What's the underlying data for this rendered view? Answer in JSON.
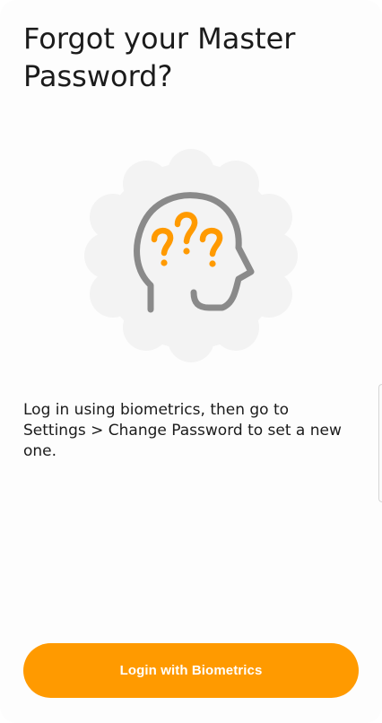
{
  "screen": {
    "title": "Forgot your Master Password?",
    "description": "Log in using biometrics, then go to Settings > Change Password to set a new one.",
    "illustration_icon": "head-with-question-marks-icon",
    "login_button_label": "Login with Biometrics"
  },
  "colors": {
    "accent": "#ff9a00",
    "icon_gray": "#8a8a8a",
    "badge_bg": "#f3f3f3",
    "text": "#1b1b1b"
  }
}
